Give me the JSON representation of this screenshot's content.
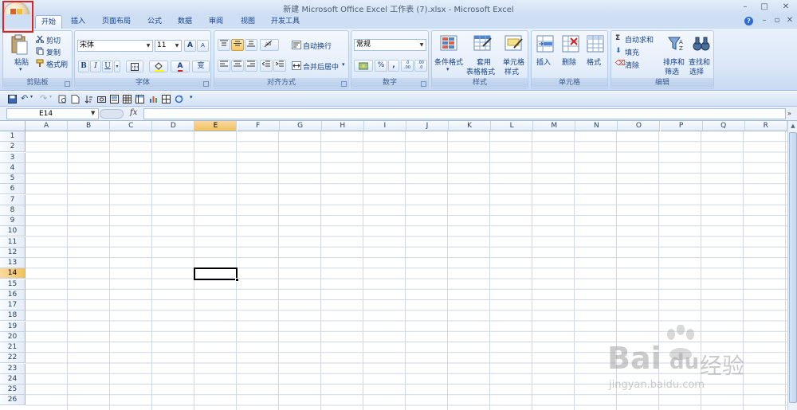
{
  "window": {
    "title": "新建 Microsoft Office Excel 工作表 (7).xlsx - Microsoft Excel",
    "controls": [
      "–",
      "□",
      "✕"
    ],
    "doc_controls": [
      "–",
      "▫",
      "✕"
    ]
  },
  "tabs": [
    {
      "label": "开始",
      "active": true
    },
    {
      "label": "插入"
    },
    {
      "label": "页面布局"
    },
    {
      "label": "公式"
    },
    {
      "label": "数据"
    },
    {
      "label": "审阅"
    },
    {
      "label": "视图"
    },
    {
      "label": "开发工具"
    }
  ],
  "ribbon": {
    "clipboard": {
      "label": "剪贴板",
      "paste": "粘贴",
      "cut": "剪切",
      "copy": "复制",
      "format_painter": "格式刷"
    },
    "font": {
      "label": "字体",
      "font_name": "宋体",
      "font_size": "11",
      "bold": "B",
      "italic": "I",
      "underline": "U",
      "grow": "A",
      "shrink": "A",
      "font_color": "A",
      "phonetic": "变"
    },
    "alignment": {
      "label": "对齐方式",
      "wrap_text": "自动换行",
      "merge_center": "合并后居中"
    },
    "number": {
      "label": "数字",
      "format": "常规",
      "percent": "%",
      "comma": ",",
      "inc_decimal": ".0 .00",
      "dec_decimal": ".00 .0"
    },
    "styles": {
      "label": "样式",
      "conditional": "条件格式",
      "table_line1": "套用",
      "table_line2": "表格格式",
      "cell_line1": "单元格",
      "cell_line2": "样式"
    },
    "cells": {
      "label": "单元格",
      "insert": "插入",
      "delete": "删除",
      "format": "格式"
    },
    "editing": {
      "label": "编辑",
      "autosum": "自动求和",
      "fill": "填充",
      "clear": "清除",
      "sort_line1": "排序和",
      "sort_line2": "筛选",
      "find_line1": "查找和",
      "find_line2": "选择"
    }
  },
  "formula_bar": {
    "name_box": "E14",
    "fx": "fx",
    "value": ""
  },
  "columns": [
    "A",
    "B",
    "C",
    "D",
    "E",
    "F",
    "G",
    "H",
    "I",
    "J",
    "K",
    "L",
    "M",
    "N",
    "O",
    "P",
    "Q",
    "R"
  ],
  "rows": [
    "1",
    "2",
    "3",
    "4",
    "5",
    "6",
    "7",
    "8",
    "9",
    "10",
    "11",
    "12",
    "13",
    "14",
    "15",
    "16",
    "17",
    "18",
    "19",
    "20",
    "21",
    "22",
    "23",
    "24",
    "25",
    "26"
  ],
  "selected": {
    "column": "E",
    "row": "14"
  },
  "watermark": {
    "brand": "Bai",
    "brand2": "du",
    "cn": "经验",
    "url": "jingyan.baidu.com"
  },
  "colors": {
    "highlight": "#e0241d",
    "selected_header": "#f1c15f",
    "ribbon": "#dbe7f7"
  }
}
